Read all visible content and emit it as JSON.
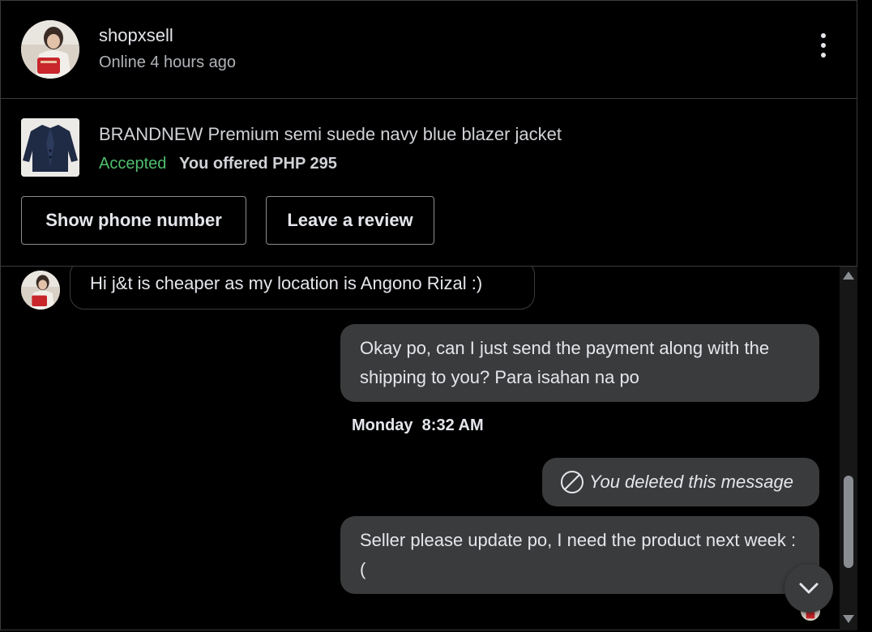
{
  "header": {
    "seller_name": "shopxsell",
    "status": "Online 4 hours ago",
    "more_icon": "more-vertical-icon"
  },
  "product": {
    "title": "BRANDNEW Premium semi suede navy blue blazer jacket",
    "offer_status": "Accepted",
    "offer_text": "You offered PHP 295",
    "show_phone_label": "Show phone number",
    "leave_review_label": "Leave a review"
  },
  "messages": {
    "incoming": "Hi j&t is cheaper as my location is Angono Rizal :)",
    "outgoing_1": "Okay po, can I just send the payment along with the shipping to you? Para isahan na po",
    "timestamp": "Monday  8:32 AM",
    "deleted": "You deleted this message",
    "outgoing_2": "Seller please update po, I need the product next week :("
  },
  "colors": {
    "background": "#000000",
    "bubble": "#3a3b3c",
    "accepted": "#4fbf6e",
    "muted_text": "#b0b3b8"
  }
}
